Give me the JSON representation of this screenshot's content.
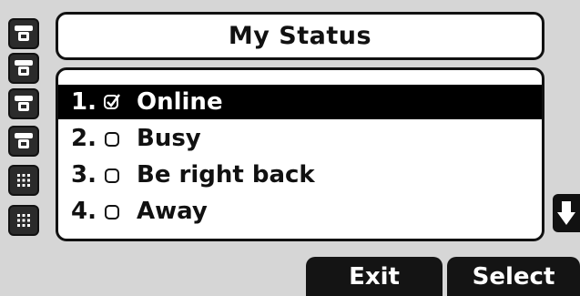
{
  "title": "My Status",
  "status_options": [
    {
      "number": "1.",
      "label": "Online",
      "checked": true,
      "selected": true
    },
    {
      "number": "2.",
      "label": "Busy",
      "checked": false,
      "selected": false
    },
    {
      "number": "3.",
      "label": "Be right back",
      "checked": false,
      "selected": false
    },
    {
      "number": "4.",
      "label": "Away",
      "checked": false,
      "selected": false
    }
  ],
  "line_keys": [
    "phone-handset-icon",
    "phone-handset-icon",
    "phone-handset-icon",
    "phone-handset-icon",
    "keypad-icon",
    "keypad-icon"
  ],
  "scroll_indicator": "arrow-down-icon",
  "softkeys": {
    "exit": "Exit",
    "select": "Select"
  },
  "colors": {
    "screen": "#d6d6d6",
    "selection": "#000000",
    "softkey": "#141414"
  }
}
